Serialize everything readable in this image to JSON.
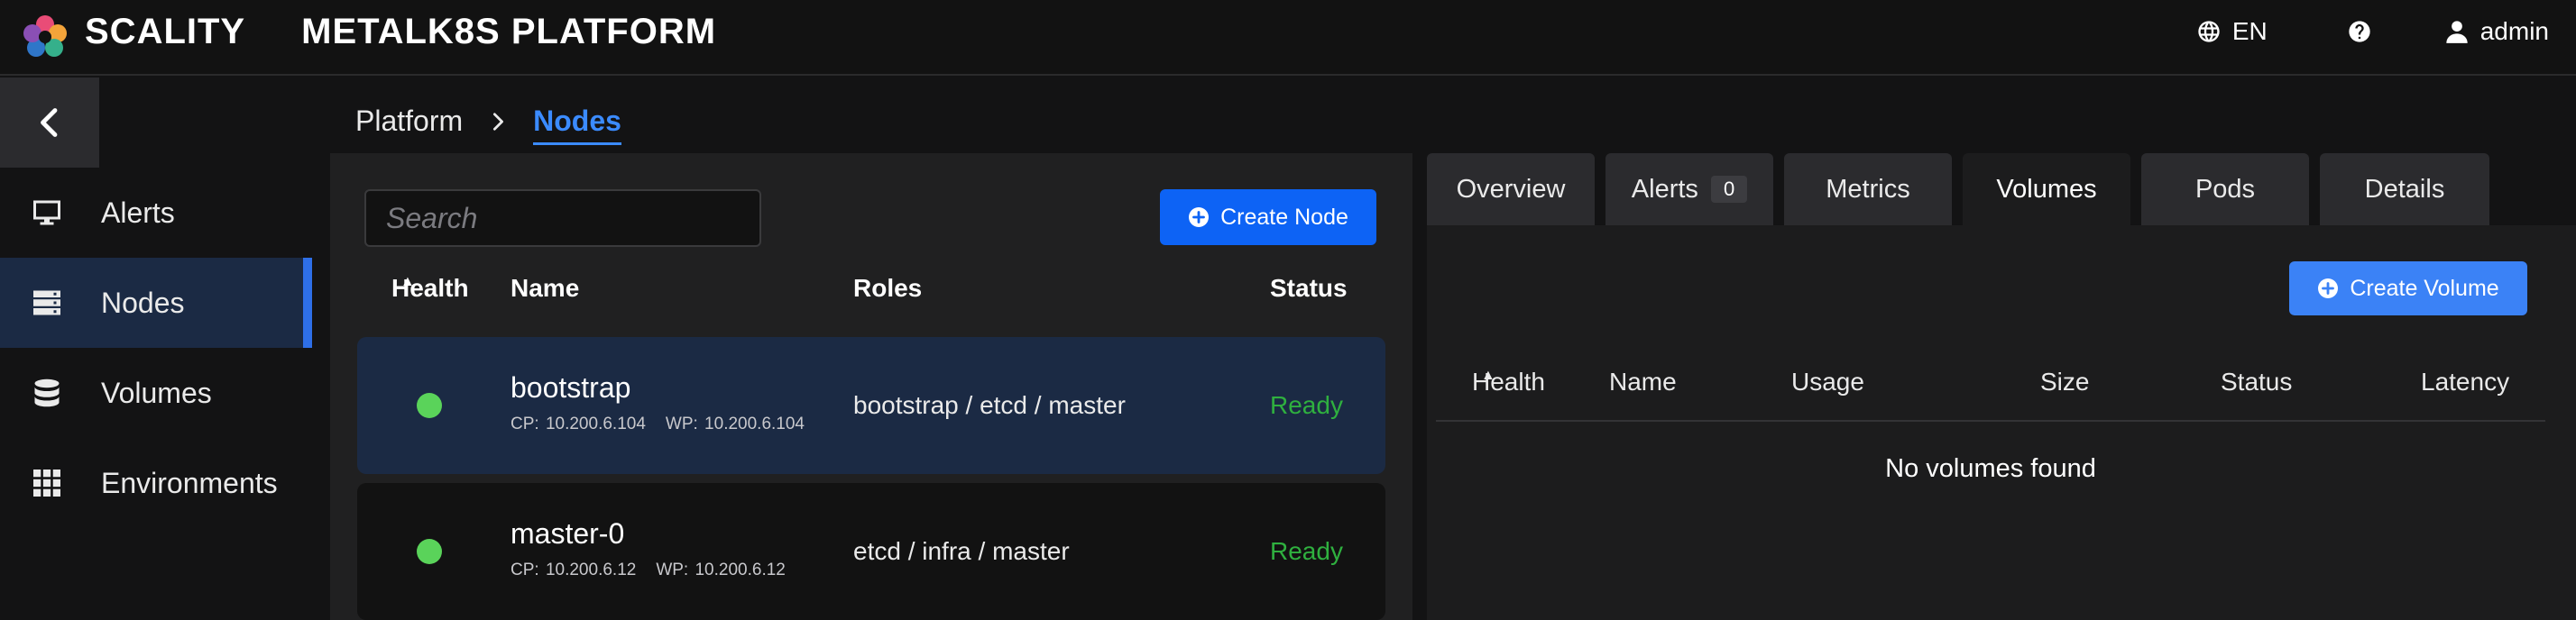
{
  "navbar": {
    "brand_name": "SCALITY",
    "product_name": "METALK8S PLATFORM",
    "language": "EN",
    "user": "admin"
  },
  "sidebar": {
    "items": [
      {
        "label": "Alerts",
        "icon": "monitor-icon"
      },
      {
        "label": "Nodes",
        "icon": "server-icon",
        "selected": true
      },
      {
        "label": "Volumes",
        "icon": "database-icon"
      },
      {
        "label": "Environments",
        "icon": "grid-icon"
      }
    ]
  },
  "breadcrumb": {
    "items": [
      "Platform",
      "Nodes"
    ]
  },
  "nodes": {
    "search_placeholder": "Search",
    "create_label": "Create Node",
    "columns": [
      "Health",
      "Name",
      "Roles",
      "Status"
    ],
    "rows": [
      {
        "name": "bootstrap",
        "cp_ip": "CP: 10.200.6.104",
        "wp_ip": "WP: 10.200.6.104",
        "roles": "bootstrap / etcd / master",
        "status": "Ready",
        "selected": true
      },
      {
        "name": "master-0",
        "cp_ip": "CP: 10.200.6.12",
        "wp_ip": "WP: 10.200.6.12",
        "roles": "etcd / infra / master",
        "status": "Ready",
        "selected": false
      }
    ]
  },
  "tabs": [
    {
      "label": "Overview"
    },
    {
      "label": "Alerts",
      "badge": "0"
    },
    {
      "label": "Metrics"
    },
    {
      "label": "Volumes",
      "active": true
    },
    {
      "label": "Pods"
    },
    {
      "label": "Details"
    }
  ],
  "volumes": {
    "create_label": "Create Volume",
    "columns": [
      "Health",
      "Name",
      "Usage",
      "Size",
      "Status",
      "Latency"
    ],
    "empty_message": "No volumes found"
  },
  "colors": {
    "accent": "#0d63f5",
    "selected_bg": "#1b2a44",
    "status_ready": "#2fb03f",
    "health_ok": "#5ad35a"
  }
}
